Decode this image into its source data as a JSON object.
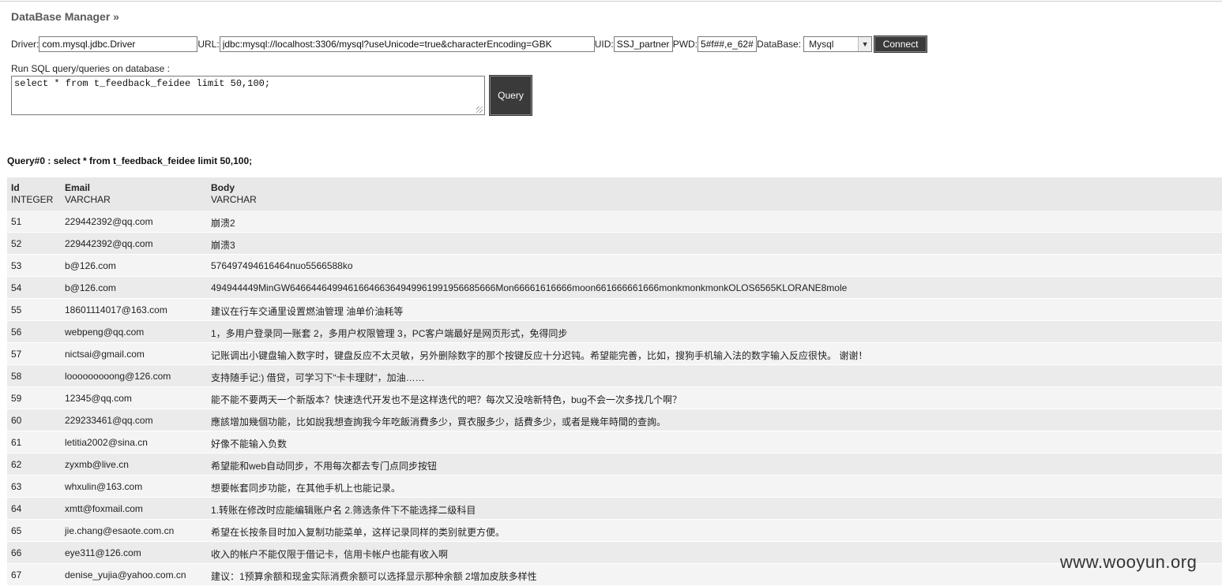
{
  "header": {
    "title": "DataBase Manager »"
  },
  "connection": {
    "driver_label": "Driver:",
    "driver_value": "com.mysql.jdbc.Driver",
    "url_label": "URL:",
    "url_value": "jdbc:mysql://localhost:3306/mysql?useUnicode=true&characterEncoding=GBK",
    "uid_label": "UID:",
    "uid_value": "SSJ_partner,",
    "pwd_label": "PWD:",
    "pwd_value": "5#f##,e_62#",
    "database_label": "DataBase:",
    "database_selected": "Mysql",
    "connect_label": "Connect"
  },
  "sql": {
    "label": "Run SQL query/queries on database :",
    "query_text": "select * from t_feedback_feidee limit 50,100;",
    "query_button": "Query"
  },
  "result": {
    "heading": "Query#0 : select * from t_feedback_feidee limit 50,100;",
    "columns": [
      {
        "name": "Id",
        "type": "INTEGER"
      },
      {
        "name": "Email",
        "type": "VARCHAR"
      },
      {
        "name": "Body",
        "type": "VARCHAR"
      }
    ],
    "rows": [
      {
        "id": "51",
        "email": "229442392@qq.com",
        "body": "崩溃2"
      },
      {
        "id": "52",
        "email": "229442392@qq.com",
        "body": "崩溃3"
      },
      {
        "id": "53",
        "email": "b@126.com",
        "body": "576497494616464nuo5566588ko"
      },
      {
        "id": "54",
        "email": "b@126.com",
        "body": "494944449MinGW646644649946166466364949961991956685666Mon66661616666moon661666661666monkmonkmonkOLOS6565KLORANE8mole"
      },
      {
        "id": "55",
        "email": "18601114017@163.com",
        "body": "建议在行车交通里设置燃油管理 油单价油耗等"
      },
      {
        "id": "56",
        "email": "webpeng@qq.com",
        "body": "1，多用户登录同一账套 2，多用户权限管理 3，PC客户端最好是网页形式，免得同步"
      },
      {
        "id": "57",
        "email": "nictsai@gmail.com",
        "body": "记账调出小键盘输入数字时，键盘反应不太灵敏，另外删除数字的那个按键反应十分迟钝。希望能完善，比如，搜狗手机输入法的数字输入反应很快。 谢谢！"
      },
      {
        "id": "58",
        "email": "looooooooong@126.com",
        "body": "支持随手记:) 借贷，可学习下“卡卡理财”，加油……"
      },
      {
        "id": "59",
        "email": "12345@qq.com",
        "body": "能不能不要两天一个新版本？快速迭代开发也不是这样迭代的吧？每次又没啥新特色，bug不会一次多找几个啊？"
      },
      {
        "id": "60",
        "email": "229233461@qq.com",
        "body": "應該增加幾個功能，比如說我想查詢我今年吃飯消費多少，買衣服多少，話費多少，或者是幾年時間的查詢。"
      },
      {
        "id": "61",
        "email": "letitia2002@sina.cn",
        "body": "好像不能输入负数"
      },
      {
        "id": "62",
        "email": "zyxmb@live.cn",
        "body": "希望能和web自动同步，不用每次都去专门点同步按钮"
      },
      {
        "id": "63",
        "email": "whxulin@163.com",
        "body": "想要帐套同步功能，在其他手机上也能记录。"
      },
      {
        "id": "64",
        "email": "xmtt@foxmail.com",
        "body": "1.转账在修改时应能编辑账户名 2.筛选条件下不能选择二级科目"
      },
      {
        "id": "65",
        "email": "jie.chang@esaote.com.cn",
        "body": "希望在长按条目时加入复制功能菜单，这样记录同样的类别就更方便。"
      },
      {
        "id": "66",
        "email": "eye311@126.com",
        "body": "收入的帐户不能仅限于借记卡，信用卡帐户也能有收入啊"
      },
      {
        "id": "67",
        "email": "denise_yujia@yahoo.com.cn",
        "body": "建议：1预算余额和现金实际消费余额可以选择显示那种余额 2增加皮肤多样性"
      }
    ]
  },
  "watermark": "www.wooyun.org"
}
